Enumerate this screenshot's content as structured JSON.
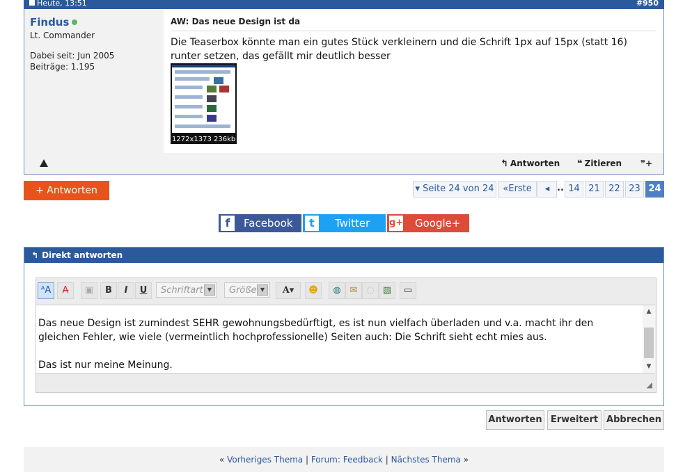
{
  "post": {
    "date": "Heute, 13:51",
    "number": "#950",
    "username": "Findus",
    "rank": "Lt. Commander",
    "joined": "Dabei seit: Jun 2005",
    "posts": "Beiträge: 1.195",
    "title": "AW: Das neue Design ist da",
    "text": "Die Teaserbox könnte man ein gutes Stück verkleinern und die Schrift 1px auf 15px (statt 16) runter setzen, das gefällt mir deutlich besser",
    "attachment_caption": "1272x1373 236kb",
    "actions": {
      "reply": "Antworten",
      "quote": "Zitieren",
      "report_icon": "warning-icon",
      "multiquote_icon": "multiquote-icon"
    }
  },
  "reply_button": "+ Antworten",
  "pagination": {
    "label": "Seite 24 von 24",
    "first": "Erste",
    "prev_icon": "◂",
    "dots": "...",
    "pages": [
      "14",
      "21",
      "22",
      "23",
      "24"
    ],
    "current": "24"
  },
  "social": {
    "facebook": "Facebook",
    "twitter": "Twitter",
    "google": "Google+",
    "colors": {
      "facebook": "#3b5998",
      "twitter": "#1da1f2",
      "google": "#dd4b39"
    }
  },
  "quick_reply": {
    "title": "Direkt antworten",
    "toolbar": {
      "font_placeholder": "Schriftart",
      "size_placeholder": "Größe",
      "bold": "B",
      "italic": "I",
      "underline": "U",
      "text_color": "A"
    },
    "content": [
      "Das neue Design ist zumindest SEHR gewohnungsbedürftigt, es ist nun vielfach überladen und v.a. macht ihr den gleichen Fehler, wie viele (vermeintlich hochprofessionelle) Seiten auch: Die Schrift sieht echt mies aus.",
      "Das ist nur meine Meinung."
    ]
  },
  "form_buttons": {
    "submit": "Antworten",
    "advanced": "Erweitert",
    "cancel": "Abbrechen"
  },
  "thread_nav": {
    "prev": "Vorheriges Thema",
    "forum": "Forum: Feedback",
    "next": "Nächstes Thema"
  },
  "colors": {
    "brand_blue": "#2b5a9c",
    "reply_orange": "#e8531b",
    "online_green": "#5cb85c"
  }
}
